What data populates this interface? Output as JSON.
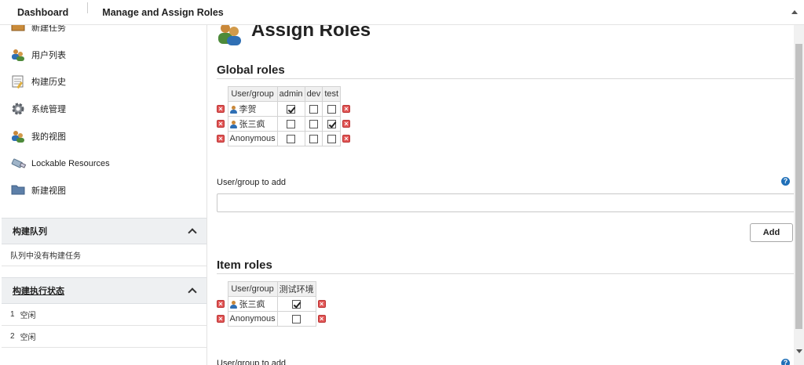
{
  "breadcrumb": {
    "items": [
      "Dashboard",
      "Manage and Assign Roles"
    ]
  },
  "sidebar": {
    "items": [
      {
        "label": "新建任务",
        "icon": "new-job-icon"
      },
      {
        "label": "用户列表",
        "icon": "users-icon"
      },
      {
        "label": "构建历史",
        "icon": "notepad-icon"
      },
      {
        "label": "系统管理",
        "icon": "gear-icon"
      },
      {
        "label": "我的视图",
        "icon": "users-icon"
      },
      {
        "label": "Lockable Resources",
        "icon": "usb-icon"
      },
      {
        "label": "新建视图",
        "icon": "folder-icon"
      }
    ],
    "queue": {
      "title": "构建队列",
      "empty_text": "队列中没有构建任务"
    },
    "executors": {
      "title": "构建执行状态",
      "rows": [
        {
          "num": "1",
          "status": "空闲"
        },
        {
          "num": "2",
          "status": "空闲"
        }
      ]
    }
  },
  "page": {
    "title": "Assign Roles",
    "global": {
      "heading": "Global roles",
      "columns": [
        "User/group",
        "admin",
        "dev",
        "test"
      ],
      "rows": [
        {
          "user": "李贺",
          "user_icon": true,
          "checks": [
            true,
            false,
            false
          ]
        },
        {
          "user": "张三疯",
          "user_icon": true,
          "checks": [
            false,
            false,
            true
          ]
        },
        {
          "user": "Anonymous",
          "user_icon": false,
          "checks": [
            false,
            false,
            false
          ]
        }
      ],
      "add_label": "User/group to add",
      "add_value": "",
      "add_button": "Add"
    },
    "item": {
      "heading": "Item roles",
      "columns": [
        "User/group",
        "测试环境"
      ],
      "rows": [
        {
          "user": "张三疯",
          "user_icon": true,
          "checks": [
            true
          ]
        },
        {
          "user": "Anonymous",
          "user_icon": false,
          "checks": [
            false
          ]
        }
      ],
      "add_label": "User/group to add"
    }
  },
  "colors": {
    "delete": "#e25757",
    "help": "#1f6fb8",
    "panel_header": "#eef0f2"
  }
}
